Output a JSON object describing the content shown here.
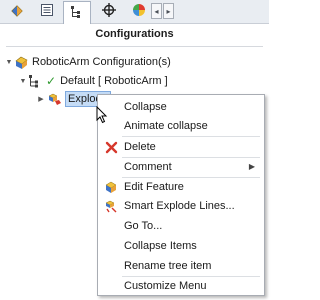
{
  "tabs": [
    {
      "name": "feature-manager",
      "icon": "feature-tree-icon"
    },
    {
      "name": "property-manager",
      "icon": "property-list-icon"
    },
    {
      "name": "configuration-manager",
      "icon": "configuration-icon",
      "active": true
    },
    {
      "name": "dimxpert",
      "icon": "crosshair-icon"
    },
    {
      "name": "display-manager",
      "icon": "appearance-pie-icon"
    }
  ],
  "header": {
    "title": "Configurations"
  },
  "tree": {
    "root_label": "RoboticArm Configuration(s)",
    "default_label": "Default [ RoboticArm ]",
    "explode_label": "Explode"
  },
  "menu": {
    "items": [
      {
        "label": "Collapse",
        "icon": ""
      },
      {
        "label": "Animate collapse",
        "icon": ""
      },
      {
        "label": "Delete",
        "icon": "delete-x-icon"
      },
      {
        "label": "Comment",
        "icon": "",
        "submenu": true
      },
      {
        "label": "Edit Feature",
        "icon": "edit-feature-icon"
      },
      {
        "label": "Smart Explode Lines...",
        "icon": "smart-explode-lines-icon"
      },
      {
        "label": "Go To...",
        "icon": ""
      },
      {
        "label": "Collapse Items",
        "icon": ""
      },
      {
        "label": "Rename tree item",
        "icon": ""
      },
      {
        "label": "Customize Menu",
        "icon": ""
      }
    ]
  },
  "colors": {
    "accent_red": "#d6372b",
    "selection": "#c5dcf6",
    "check_green": "#2f9a2f",
    "part_yellow": "#e8b63a",
    "part_blue": "#3f73c6"
  }
}
